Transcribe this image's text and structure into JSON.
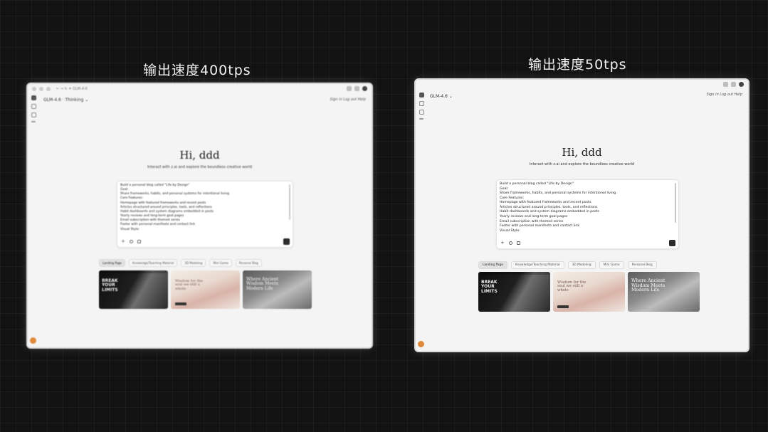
{
  "panels": [
    {
      "title": "输出速度400tps",
      "address": "← →  ↻  ✦ GLM-4.6",
      "model": "GLM-4.6 · Thinking ⌄",
      "header_links": "Sign in  Log out  Help",
      "greeting": "Hi, ddd",
      "subtitle": "Interact with z.ai and explore the boundless creative world",
      "prompt_lines": [
        "Build a personal blog called \"Life by Design\"",
        "Goal:",
        " Share frameworks, habits, and personal systems for intentional living.",
        "Core Features:",
        "Homepage with featured frameworks and recent posts",
        "Articles structured around principles, tools, and reflections",
        "Habit dashboards and system diagrams embedded in posts",
        "Yearly reviews and long-term goal pages",
        "Email subscription with themed series",
        "Footer with personal manifesto and contact link",
        "Visual Style:"
      ],
      "chips": [
        "Landing Page",
        "Knowledge/Teaching Material",
        "3D Modeling",
        "Mini Game",
        "Personal Blog"
      ],
      "thumbs": [
        {
          "text": "BREAK YOUR LIMITS"
        },
        {
          "text": "Wisdom for the soul we still a whole"
        },
        {
          "text": "Where Ancient Wisdom Meets Modern Life"
        }
      ]
    },
    {
      "title": "输出速度50tps",
      "address": "",
      "model": "GLM-4.6 ⌄",
      "header_links": "Sign in  Log out  Help",
      "greeting": "Hi, ddd",
      "subtitle": "Interact with z.ai and explore the boundless creative world",
      "prompt_lines": [
        "Build a personal blog called \"Life by Design\"",
        "Goal:",
        " Share frameworks, habits, and personal systems for intentional living.",
        "Core Features:",
        "Homepage with featured frameworks and recent posts",
        "Articles structured around principles, tools, and reflections",
        "Habit dashboards and system diagrams embedded in posts",
        "Yearly reviews and long-term goal pages",
        "Email subscription with themed series",
        "Footer with personal manifesto and contact link",
        "Visual Style:"
      ],
      "chips": [
        "Landing Page",
        "Knowledge/Teaching Material",
        "3D Modeling",
        "Mini Game",
        "Personal Blog"
      ],
      "thumbs": [
        {
          "text": "BREAK YOUR LIMITS"
        },
        {
          "text": "Wisdom for the soul we still a whole"
        },
        {
          "text": "Where Ancient Wisdom Meets Modern Life"
        }
      ]
    }
  ],
  "colors": {
    "background": "#121212",
    "window": "#f4f4f4",
    "accent_orange": "#e0893a"
  }
}
